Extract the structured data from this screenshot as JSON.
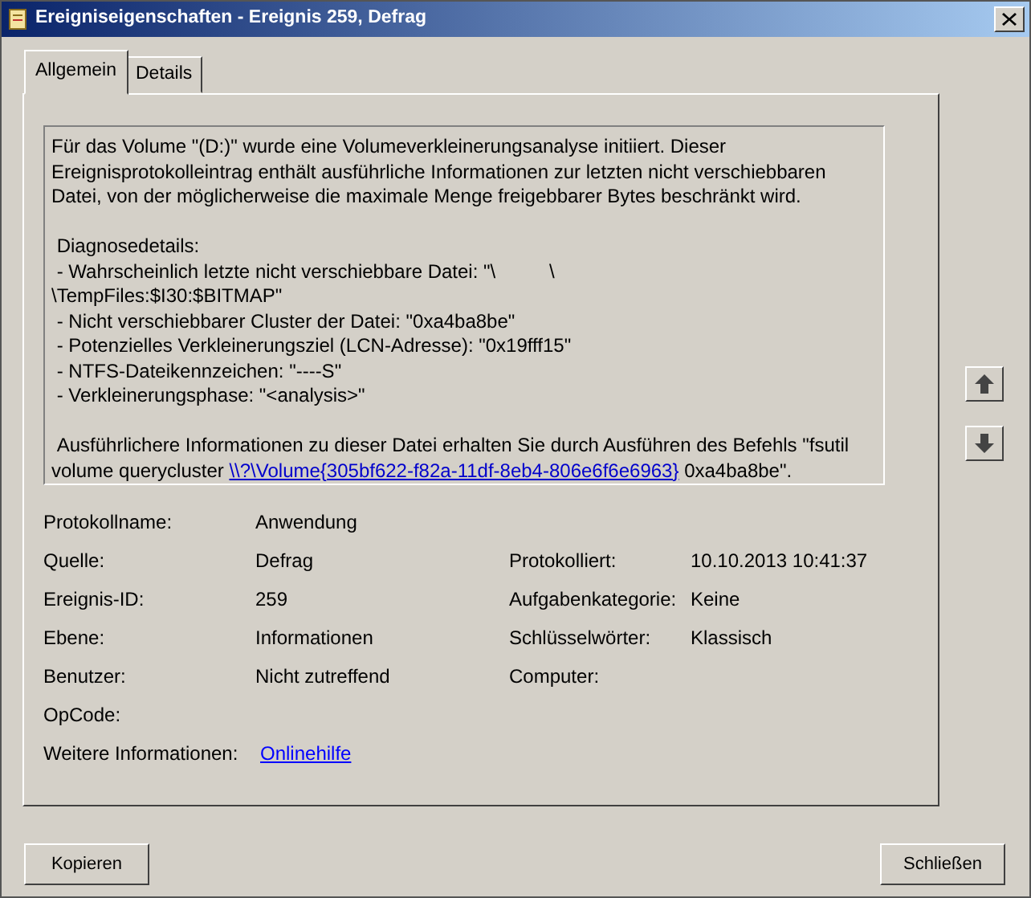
{
  "window": {
    "title": "Ereigniseigenschaften - Ereignis 259, Defrag"
  },
  "tabs": [
    {
      "label": "Allgemein",
      "selected": true
    },
    {
      "label": "Details",
      "selected": false
    }
  ],
  "description": {
    "intro": "Für das Volume \"(D:)\" wurde eine Volumeverkleinerungsanalyse initiiert. Dieser Ereignisprotokolleintrag enthält ausführliche Informationen zur letzten nicht verschiebbaren Datei, von der möglicherweise die maximale Menge freigebbarer Bytes beschränkt wird.",
    "details_heading": "Diagnosedetails:",
    "details": [
      " - Wahrscheinlich letzte nicht verschiebbare Datei: \"\\          \\                    \\TempFiles:$I30:$BITMAP\"",
      " - Nicht verschiebbarer Cluster der Datei: \"0xa4ba8be\"",
      " - Potenzielles Verkleinerungsziel (LCN-Adresse): \"0x19fff15\"",
      " - NTFS-Dateikennzeichen: \"----S\"",
      " - Verkleinerungsphase: \"<analysis>\""
    ],
    "outro_text": "Ausführlichere Informationen zu dieser Datei erhalten Sie durch Ausführen des Befehls \"fsutil volume querycluster ",
    "outro_link": "\\\\?\\Volume{305bf622-f82a-11df-8eb4-806e6f6e6963}",
    "outro_tail": " 0xa4ba8be\"."
  },
  "fields": [
    {
      "label": "Protokollname:",
      "value": "Anwendung"
    },
    {
      "label": "Quelle:",
      "value": "Defrag",
      "label_2": "Protokolliert:",
      "value_2": "10.10.2013 10:41:37"
    },
    {
      "label": "Ereignis-ID:",
      "value": "259",
      "label_2": "Aufgabenkategorie:",
      "value_2": "Keine"
    },
    {
      "label": "Ebene:",
      "value": "Informationen",
      "label_2": "Schlüsselwörter:",
      "value_2": "Klassisch"
    },
    {
      "label": "Benutzer:",
      "value": "Nicht zutreffend",
      "label_2": "Computer:"
    },
    {
      "label": "OpCode:"
    },
    {
      "label": "Weitere Informationen:",
      "link": "Onlinehilfe"
    }
  ],
  "buttons": {
    "copy": "Kopieren",
    "close": "Schließen"
  }
}
